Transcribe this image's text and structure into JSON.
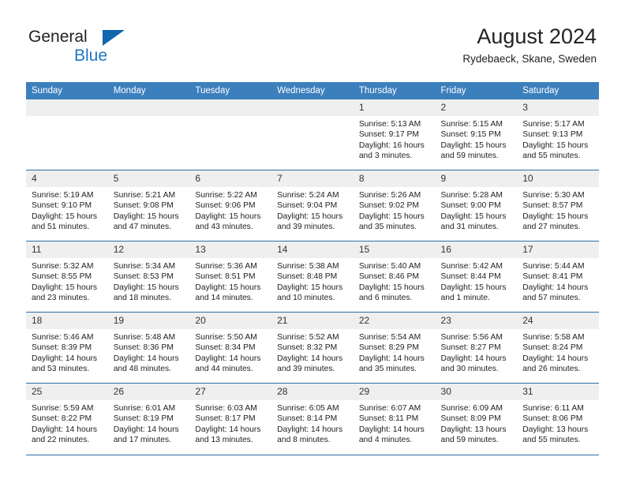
{
  "brand": {
    "name_part1": "General",
    "name_part2": "Blue",
    "logo_icon": "triangle-flag-icon"
  },
  "header": {
    "title": "August 2024",
    "location": "Rydebaeck, Skane, Sweden"
  },
  "weekday_headers": [
    "Sunday",
    "Monday",
    "Tuesday",
    "Wednesday",
    "Thursday",
    "Friday",
    "Saturday"
  ],
  "colors": {
    "header_bar": "#3c7fbd",
    "row_divider": "#2e6da4",
    "daynum_band": "#efefef",
    "brand_blue": "#1f76c4",
    "text": "#222222"
  },
  "weeks": [
    [
      {
        "day": "",
        "blank": true,
        "sunrise": "",
        "sunset": "",
        "daylight_line1": "",
        "daylight_line2": ""
      },
      {
        "day": "",
        "blank": true,
        "sunrise": "",
        "sunset": "",
        "daylight_line1": "",
        "daylight_line2": ""
      },
      {
        "day": "",
        "blank": true,
        "sunrise": "",
        "sunset": "",
        "daylight_line1": "",
        "daylight_line2": ""
      },
      {
        "day": "",
        "blank": true,
        "sunrise": "",
        "sunset": "",
        "daylight_line1": "",
        "daylight_line2": ""
      },
      {
        "day": "1",
        "blank": false,
        "sunrise": "Sunrise: 5:13 AM",
        "sunset": "Sunset: 9:17 PM",
        "daylight_line1": "Daylight: 16 hours",
        "daylight_line2": "and 3 minutes."
      },
      {
        "day": "2",
        "blank": false,
        "sunrise": "Sunrise: 5:15 AM",
        "sunset": "Sunset: 9:15 PM",
        "daylight_line1": "Daylight: 15 hours",
        "daylight_line2": "and 59 minutes."
      },
      {
        "day": "3",
        "blank": false,
        "sunrise": "Sunrise: 5:17 AM",
        "sunset": "Sunset: 9:13 PM",
        "daylight_line1": "Daylight: 15 hours",
        "daylight_line2": "and 55 minutes."
      }
    ],
    [
      {
        "day": "4",
        "blank": false,
        "sunrise": "Sunrise: 5:19 AM",
        "sunset": "Sunset: 9:10 PM",
        "daylight_line1": "Daylight: 15 hours",
        "daylight_line2": "and 51 minutes."
      },
      {
        "day": "5",
        "blank": false,
        "sunrise": "Sunrise: 5:21 AM",
        "sunset": "Sunset: 9:08 PM",
        "daylight_line1": "Daylight: 15 hours",
        "daylight_line2": "and 47 minutes."
      },
      {
        "day": "6",
        "blank": false,
        "sunrise": "Sunrise: 5:22 AM",
        "sunset": "Sunset: 9:06 PM",
        "daylight_line1": "Daylight: 15 hours",
        "daylight_line2": "and 43 minutes."
      },
      {
        "day": "7",
        "blank": false,
        "sunrise": "Sunrise: 5:24 AM",
        "sunset": "Sunset: 9:04 PM",
        "daylight_line1": "Daylight: 15 hours",
        "daylight_line2": "and 39 minutes."
      },
      {
        "day": "8",
        "blank": false,
        "sunrise": "Sunrise: 5:26 AM",
        "sunset": "Sunset: 9:02 PM",
        "daylight_line1": "Daylight: 15 hours",
        "daylight_line2": "and 35 minutes."
      },
      {
        "day": "9",
        "blank": false,
        "sunrise": "Sunrise: 5:28 AM",
        "sunset": "Sunset: 9:00 PM",
        "daylight_line1": "Daylight: 15 hours",
        "daylight_line2": "and 31 minutes."
      },
      {
        "day": "10",
        "blank": false,
        "sunrise": "Sunrise: 5:30 AM",
        "sunset": "Sunset: 8:57 PM",
        "daylight_line1": "Daylight: 15 hours",
        "daylight_line2": "and 27 minutes."
      }
    ],
    [
      {
        "day": "11",
        "blank": false,
        "sunrise": "Sunrise: 5:32 AM",
        "sunset": "Sunset: 8:55 PM",
        "daylight_line1": "Daylight: 15 hours",
        "daylight_line2": "and 23 minutes."
      },
      {
        "day": "12",
        "blank": false,
        "sunrise": "Sunrise: 5:34 AM",
        "sunset": "Sunset: 8:53 PM",
        "daylight_line1": "Daylight: 15 hours",
        "daylight_line2": "and 18 minutes."
      },
      {
        "day": "13",
        "blank": false,
        "sunrise": "Sunrise: 5:36 AM",
        "sunset": "Sunset: 8:51 PM",
        "daylight_line1": "Daylight: 15 hours",
        "daylight_line2": "and 14 minutes."
      },
      {
        "day": "14",
        "blank": false,
        "sunrise": "Sunrise: 5:38 AM",
        "sunset": "Sunset: 8:48 PM",
        "daylight_line1": "Daylight: 15 hours",
        "daylight_line2": "and 10 minutes."
      },
      {
        "day": "15",
        "blank": false,
        "sunrise": "Sunrise: 5:40 AM",
        "sunset": "Sunset: 8:46 PM",
        "daylight_line1": "Daylight: 15 hours",
        "daylight_line2": "and 6 minutes."
      },
      {
        "day": "16",
        "blank": false,
        "sunrise": "Sunrise: 5:42 AM",
        "sunset": "Sunset: 8:44 PM",
        "daylight_line1": "Daylight: 15 hours",
        "daylight_line2": "and 1 minute."
      },
      {
        "day": "17",
        "blank": false,
        "sunrise": "Sunrise: 5:44 AM",
        "sunset": "Sunset: 8:41 PM",
        "daylight_line1": "Daylight: 14 hours",
        "daylight_line2": "and 57 minutes."
      }
    ],
    [
      {
        "day": "18",
        "blank": false,
        "sunrise": "Sunrise: 5:46 AM",
        "sunset": "Sunset: 8:39 PM",
        "daylight_line1": "Daylight: 14 hours",
        "daylight_line2": "and 53 minutes."
      },
      {
        "day": "19",
        "blank": false,
        "sunrise": "Sunrise: 5:48 AM",
        "sunset": "Sunset: 8:36 PM",
        "daylight_line1": "Daylight: 14 hours",
        "daylight_line2": "and 48 minutes."
      },
      {
        "day": "20",
        "blank": false,
        "sunrise": "Sunrise: 5:50 AM",
        "sunset": "Sunset: 8:34 PM",
        "daylight_line1": "Daylight: 14 hours",
        "daylight_line2": "and 44 minutes."
      },
      {
        "day": "21",
        "blank": false,
        "sunrise": "Sunrise: 5:52 AM",
        "sunset": "Sunset: 8:32 PM",
        "daylight_line1": "Daylight: 14 hours",
        "daylight_line2": "and 39 minutes."
      },
      {
        "day": "22",
        "blank": false,
        "sunrise": "Sunrise: 5:54 AM",
        "sunset": "Sunset: 8:29 PM",
        "daylight_line1": "Daylight: 14 hours",
        "daylight_line2": "and 35 minutes."
      },
      {
        "day": "23",
        "blank": false,
        "sunrise": "Sunrise: 5:56 AM",
        "sunset": "Sunset: 8:27 PM",
        "daylight_line1": "Daylight: 14 hours",
        "daylight_line2": "and 30 minutes."
      },
      {
        "day": "24",
        "blank": false,
        "sunrise": "Sunrise: 5:58 AM",
        "sunset": "Sunset: 8:24 PM",
        "daylight_line1": "Daylight: 14 hours",
        "daylight_line2": "and 26 minutes."
      }
    ],
    [
      {
        "day": "25",
        "blank": false,
        "sunrise": "Sunrise: 5:59 AM",
        "sunset": "Sunset: 8:22 PM",
        "daylight_line1": "Daylight: 14 hours",
        "daylight_line2": "and 22 minutes."
      },
      {
        "day": "26",
        "blank": false,
        "sunrise": "Sunrise: 6:01 AM",
        "sunset": "Sunset: 8:19 PM",
        "daylight_line1": "Daylight: 14 hours",
        "daylight_line2": "and 17 minutes."
      },
      {
        "day": "27",
        "blank": false,
        "sunrise": "Sunrise: 6:03 AM",
        "sunset": "Sunset: 8:17 PM",
        "daylight_line1": "Daylight: 14 hours",
        "daylight_line2": "and 13 minutes."
      },
      {
        "day": "28",
        "blank": false,
        "sunrise": "Sunrise: 6:05 AM",
        "sunset": "Sunset: 8:14 PM",
        "daylight_line1": "Daylight: 14 hours",
        "daylight_line2": "and 8 minutes."
      },
      {
        "day": "29",
        "blank": false,
        "sunrise": "Sunrise: 6:07 AM",
        "sunset": "Sunset: 8:11 PM",
        "daylight_line1": "Daylight: 14 hours",
        "daylight_line2": "and 4 minutes."
      },
      {
        "day": "30",
        "blank": false,
        "sunrise": "Sunrise: 6:09 AM",
        "sunset": "Sunset: 8:09 PM",
        "daylight_line1": "Daylight: 13 hours",
        "daylight_line2": "and 59 minutes."
      },
      {
        "day": "31",
        "blank": false,
        "sunrise": "Sunrise: 6:11 AM",
        "sunset": "Sunset: 8:06 PM",
        "daylight_line1": "Daylight: 13 hours",
        "daylight_line2": "and 55 minutes."
      }
    ]
  ]
}
